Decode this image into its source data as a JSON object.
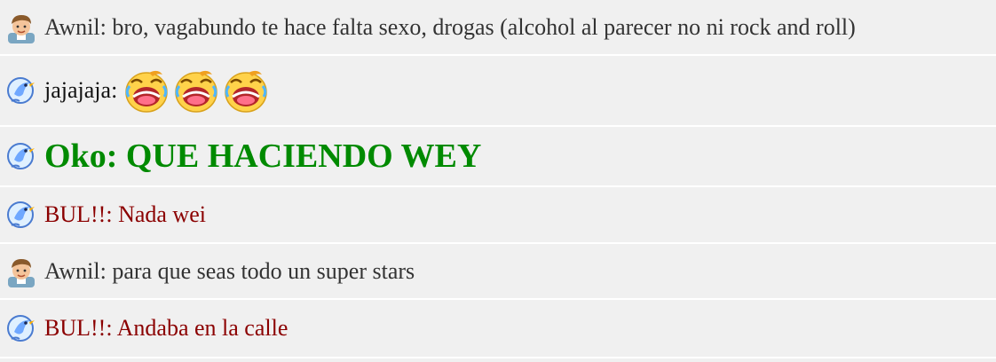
{
  "messages": [
    {
      "user": "Awnil",
      "text": "bro, vagabundo te hace falta sexo, drogas (alcohol al parecer no ni rock and roll)",
      "avatar": "boy-avatar-icon",
      "color": "#333333"
    },
    {
      "user": "jajajaja",
      "text": "",
      "avatar": "bird-avatar-icon",
      "color": "#111111",
      "emotes": [
        "laughing-crying-emoji-icon",
        "laughing-crying-emoji-icon",
        "laughing-crying-emoji-icon"
      ]
    },
    {
      "user": "Oko",
      "text": "QUE HACIENDO WEY",
      "avatar": "bird-avatar-icon",
      "color": "#008a00"
    },
    {
      "user": "BUL!!",
      "text": "Nada wei",
      "avatar": "bird-avatar-icon",
      "color": "#8b0000"
    },
    {
      "user": "Awnil",
      "text": "para que seas todo un super stars",
      "avatar": "boy-avatar-icon",
      "color": "#333333"
    },
    {
      "user": "BUL!!",
      "text": "Andaba en la calle",
      "avatar": "bird-avatar-icon",
      "color": "#8b0000"
    }
  ]
}
